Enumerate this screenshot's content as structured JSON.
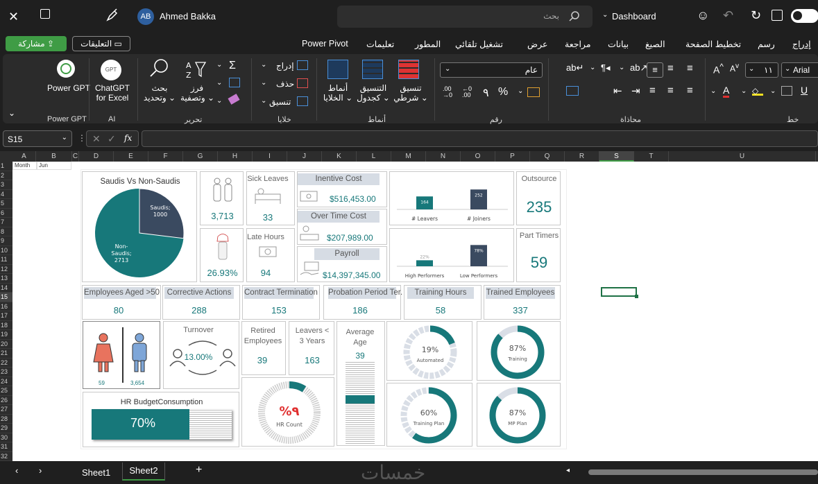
{
  "titlebar": {
    "user_initials": "AB",
    "user_name": "Ahmed Bakka",
    "search_placeholder": "بحث",
    "doc_name": "Dashboard"
  },
  "menu": {
    "share": "مشاركة",
    "comments": "التعليقات",
    "tabs": [
      "Power Pivot",
      "تعليمات",
      "المطور",
      "تشغيل تلقائي",
      "عرض",
      "مراجعة",
      "بيانات",
      "الصيغ",
      "تخطيط الصفحة",
      "رسم",
      "إدراج"
    ]
  },
  "ribbon": {
    "powergpt": "Power GPT",
    "chatgpt_line1": "ChatGPT",
    "chatgpt_line2": "for Excel",
    "grp_powergpt": "Power GPT",
    "grp_ai": "AI",
    "search_line1": "بحث",
    "search_line2": "وتحديد",
    "sort_line1": "فرز",
    "sort_line2": "وتصفية",
    "grp_edit": "تحرير",
    "insert": "إدراج",
    "delete": "حذف",
    "format": "تنسيق",
    "grp_cells": "خلايا",
    "cell_styles_1": "أنماط",
    "cell_styles_2": "الخلايا",
    "format_table_1": "التنسيق",
    "format_table_2": "كجدول",
    "cond_format_1": "تنسيق",
    "cond_format_2": "شرطي",
    "grp_styles": "أنماط",
    "number_format": "عام",
    "grp_number": "رقم",
    "grp_align": "محاذاة",
    "font_size": "١١",
    "font_name": "Arial",
    "grp_font": "خط"
  },
  "formula": {
    "namebox": "S15",
    "fx": "fx"
  },
  "columns": [
    "A",
    "B",
    "C",
    "D",
    "E",
    "F",
    "G",
    "H",
    "I",
    "J",
    "K",
    "L",
    "M",
    "N",
    "O",
    "P",
    "Q",
    "R",
    "S",
    "T",
    "U"
  ],
  "rows": [
    "1",
    "2",
    "3",
    "4",
    "5",
    "6",
    "7",
    "8",
    "9",
    "10",
    "11",
    "12",
    "13",
    "14",
    "15",
    "16",
    "17",
    "18",
    "19",
    "20",
    "21",
    "22",
    "23",
    "24",
    "25",
    "26",
    "27",
    "28",
    "29",
    "30",
    "31",
    "32"
  ],
  "cells": {
    "a1": "Month",
    "b1": "Jun"
  },
  "dashboard": {
    "pie_title": "Saudis Vs Non-Saudis",
    "pie_saudis_label": "Saudis;",
    "pie_saudis_value": "1000",
    "pie_non_label1": "Non-",
    "pie_non_label2": "Saudis;",
    "pie_non_value": "2713",
    "total_emp": "3,713",
    "saudization": "26.93%",
    "sick_leaves_title": "Sick Leaves",
    "sick_leaves": "33",
    "late_hours_title": "Late Hours",
    "late_hours": "94",
    "incentive_title": "Inentive Cost",
    "incentive": "$516,453.00",
    "overtime_title": "Over Time Cost",
    "overtime": "$207,989.00",
    "payroll_title": "Payroll",
    "payroll": "$14,397,345.00",
    "leavers_bar_value": "164",
    "joiners_bar_value": "252",
    "leavers_label": "# Leavers",
    "joiners_label": "# Joiners",
    "high_perf_value": "22%",
    "low_perf_value": "78%",
    "high_perf_label": "High Performers",
    "low_perf_label": "Low Performers",
    "outsource_title": "Outsource",
    "outsource": "235",
    "parttimers_title": "Part Timers",
    "parttimers": "59",
    "kpis": [
      {
        "title": "Employees Aged >50",
        "value": "80"
      },
      {
        "title": "Corrective Actions",
        "value": "288"
      },
      {
        "title": "Contract Termination",
        "value": "153"
      },
      {
        "title": "Probation Period Ter.",
        "value": "186"
      },
      {
        "title": "Training Hours",
        "value": "58"
      },
      {
        "title": "Trained Employees",
        "value": "337"
      }
    ],
    "female_count": "59",
    "male_count": "3,654",
    "turnover_title": "Turnover",
    "turnover": "13.00%",
    "retired_title1": "Retired",
    "retired_title2": "Employees",
    "retired": "39",
    "leavers3_title1": "Leavers <",
    "leavers3_title2": "3 Years",
    "leavers3": "163",
    "avg_age_title1": "Average",
    "avg_age_title2": "Age",
    "avg_age": "39",
    "automated_pct": "19%",
    "automated_label": "Automated",
    "training_pct": "87%",
    "training_label": "Training",
    "training_plan_pct": "60%",
    "training_plan_label": "Training Plan",
    "mp_plan_pct": "87%",
    "mp_plan_label": "MP Plan",
    "hr_count_pct": "%٩",
    "hr_count_label": "HR Count",
    "budget_title": "HR BudgetConsumption",
    "budget": "70%",
    "colors": {
      "teal": "#17787a",
      "navy": "#3a4a60",
      "light": "#d9dee6",
      "red": "#e74c3c"
    }
  },
  "sheets": {
    "s1": "Sheet1",
    "s2": "Sheet2"
  },
  "watermark": "خمسات"
}
